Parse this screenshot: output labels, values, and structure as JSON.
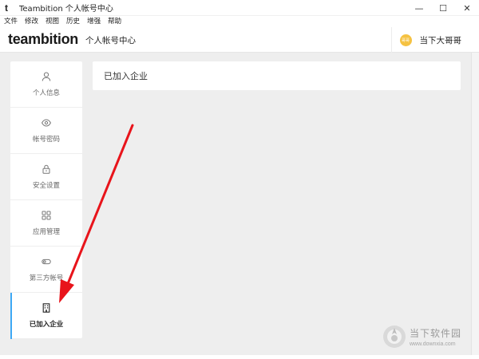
{
  "window": {
    "title": "Teambition 个人帐号中心",
    "logo_letter": "t",
    "controls": {
      "minimize": "—",
      "maximize": "☐",
      "close": "✕"
    }
  },
  "menu": [
    "文件",
    "修改",
    "视图",
    "历史",
    "增强",
    "帮助"
  ],
  "header": {
    "brand": "teambition",
    "page_title": "个人帐号中心",
    "user": {
      "avatar_text": "哥哥",
      "name": "当下大哥哥"
    }
  },
  "sidebar": {
    "items": [
      {
        "label": "个人信息",
        "icon": "user-icon",
        "active": false
      },
      {
        "label": "帐号密码",
        "icon": "eye-icon",
        "active": false
      },
      {
        "label": "安全设置",
        "icon": "lock-icon",
        "active": false
      },
      {
        "label": "应用管理",
        "icon": "apps-grid-icon",
        "active": false
      },
      {
        "label": "第三方帐号",
        "icon": "toggle-icon",
        "active": false
      },
      {
        "label": "已加入企业",
        "icon": "building-icon",
        "active": true
      }
    ]
  },
  "content": {
    "title": "已加入企业"
  },
  "watermark": {
    "text": "当下软件园",
    "url": "www.downxia.com"
  },
  "colors": {
    "accent": "#3da8f5",
    "avatar": "#f5c242",
    "annotation_arrow": "#e8141b",
    "background": "#eeeeee"
  }
}
